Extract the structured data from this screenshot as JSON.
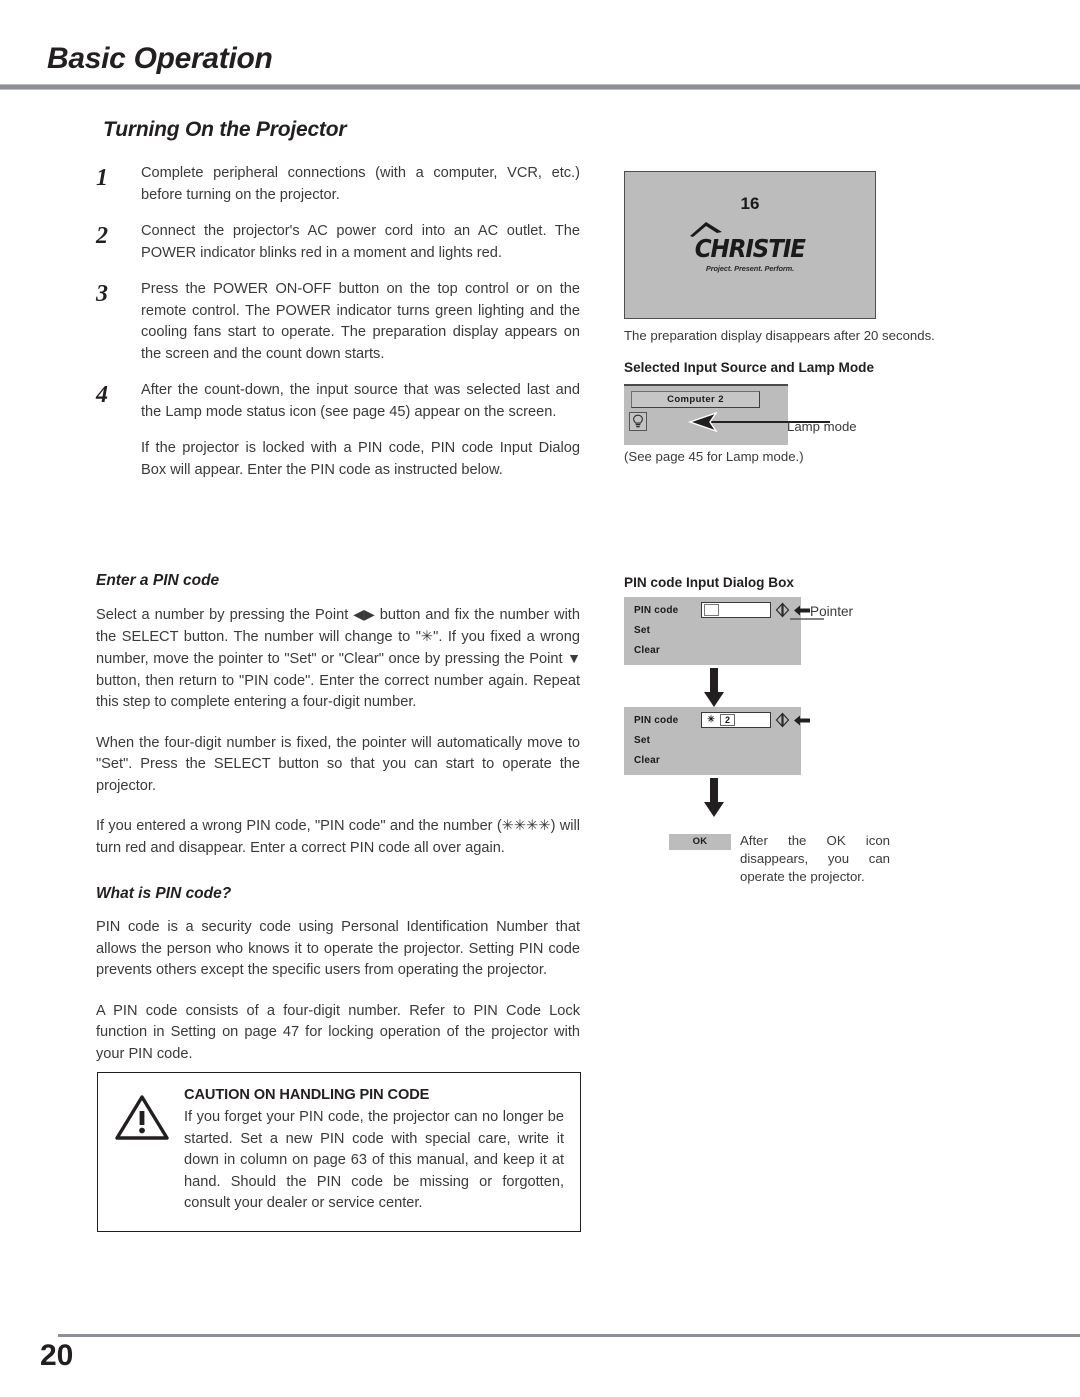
{
  "header": {
    "chapter_title": "Basic Operation",
    "section_title": "Turning On the Projector"
  },
  "steps": [
    {
      "number": "1",
      "text": "Complete peripheral connections (with a computer, VCR, etc.) before turning on the projector."
    },
    {
      "number": "2",
      "text": "Connect the projector's AC power cord into an AC outlet. The POWER indicator blinks red in a moment and lights red."
    },
    {
      "number": "3",
      "text": "Press the POWER ON-OFF button on the top control or on the remote control.  The POWER indicator turns green lighting and the cooling fans start to operate.  The preparation display appears on the screen and the count down starts."
    },
    {
      "number": "4",
      "text": "After the count-down, the input source that was selected last and the Lamp mode status icon (see page 45) appear on the screen."
    }
  ],
  "step4_followup": "If the projector is locked with a PIN code, PIN code Input Dialog Box will appear.  Enter the PIN code as instructed below.",
  "enter_pin": {
    "heading": "Enter a PIN code",
    "para1_a": "Select a number by pressing the Point ",
    "para1_arrows": "◀▶",
    "para1_b": " button and fix the number with the SELECT button.  The number will change to \"✳\".  If you fixed a wrong number, move the pointer to \"Set\" or \"Clear\" once by pressing the Point ",
    "para1_down": "▼",
    "para1_c": " button, then return to \"PIN code\".  Enter the correct number again. Repeat this step to complete entering a four-digit number.",
    "para2": "When the four-digit number is fixed, the pointer will automatically move to \"Set\".  Press the SELECT button so that you can start to operate the projector.",
    "para3": "If you entered a wrong PIN code, \"PIN code\" and the number (✳✳✳✳) will turn red and disappear.  Enter a correct PIN code all over again."
  },
  "what_pin": {
    "heading": "What is PIN code?",
    "para1": "PIN code is a security code using Personal Identification Number that allows the person who knows it to operate the projector.  Setting PIN code prevents others except the specific users from operating the projector.",
    "para2": "A PIN code consists of a four-digit number.  Refer to PIN Code Lock function in Setting on page 47 for locking operation of the projector with your PIN code."
  },
  "caution": {
    "title": "CAUTION ON HANDLING PIN CODE",
    "text": "If you forget your PIN code, the projector can no longer be started.  Set a new PIN code with special care, write it down in column on page 63 of this manual, and keep it at hand.  Should the PIN code be missing or forgotten, consult your dealer or service center."
  },
  "figures": {
    "preparation_screen": {
      "countdown": "16",
      "logo_word": "CHRISTIE",
      "logo_tagline": "Project. Present. Perform.",
      "caption": "The preparation display disappears after 20 seconds."
    },
    "lamp_mode": {
      "heading": "Selected Input Source and Lamp Mode",
      "input_source": "Computer 2",
      "pointer_label": "Lamp mode",
      "note": "(See page 45 for Lamp mode.)"
    },
    "pin_dialog": {
      "heading": "PIN code Input Dialog Box",
      "pointer_label": "Pointer",
      "dialog1": {
        "label": "PIN code",
        "set_label": "Set",
        "clear_label": "Clear",
        "cells": [
          "",
          "",
          "",
          ""
        ]
      },
      "dialog2": {
        "label": "PIN code",
        "set_label": "Set",
        "clear_label": "Clear",
        "cells": [
          "✳",
          "2",
          "",
          ""
        ]
      },
      "ok_chip": "OK",
      "ok_note": "After the OK icon disappears, you can operate the projector."
    }
  },
  "footer": {
    "page_number": "20"
  },
  "colors": {
    "screen_gray": "#bcbcbc",
    "rule_gray": "#8c9096",
    "text": "#3a3a3c",
    "heading": "#231f20"
  }
}
